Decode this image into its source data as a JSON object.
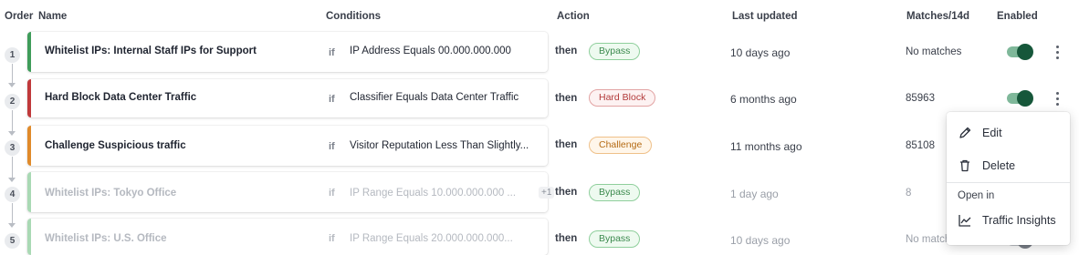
{
  "header": {
    "order": "Order",
    "name": "Name",
    "conditions": "Conditions",
    "action": "Action",
    "last_updated": "Last updated",
    "matches": "Matches/14d",
    "enabled": "Enabled"
  },
  "rules": [
    {
      "order": "1",
      "name": "Whitelist IPs: Internal Staff IPs for Support",
      "if": "if",
      "condition": "IP Address Equals 00.000.000.000",
      "then": "then",
      "action": "Bypass",
      "updated": "10 days ago",
      "matches": "No matches",
      "accent": "#3f9c5a"
    },
    {
      "order": "2",
      "name": "Hard Block Data Center Traffic",
      "if": "if",
      "condition": "Classifier Equals Data Center Traffic",
      "then": "then",
      "action": "Hard Block",
      "updated": "6 months ago",
      "matches": "85963",
      "accent": "#c0393b"
    },
    {
      "order": "3",
      "name": "Challenge Suspicious traffic",
      "if": "if",
      "condition": "Visitor Reputation Less Than Slightly...",
      "then": "then",
      "action": "Challenge",
      "updated": "11 months ago",
      "matches": "85108",
      "accent": "#e08a2a"
    },
    {
      "order": "4",
      "name": "Whitelist IPs: Tokyo Office",
      "if": "if",
      "condition": "IP Range Equals 10.000.000.000 ...",
      "extra": "+1",
      "then": "then",
      "action": "Bypass",
      "updated": "1 day ago",
      "matches": "8",
      "accent": "#a9d9b4"
    },
    {
      "order": "5",
      "name": "Whitelist IPs: U.S. Office",
      "if": "if",
      "condition": "IP Range Equals 20.000.000.000...",
      "then": "then",
      "action": "Bypass",
      "updated": "10 days ago",
      "matches": "No matches",
      "accent": "#a9d9b4"
    }
  ],
  "menu": {
    "edit": "Edit",
    "delete": "Delete",
    "section": "Open in",
    "insights": "Traffic Insights"
  }
}
